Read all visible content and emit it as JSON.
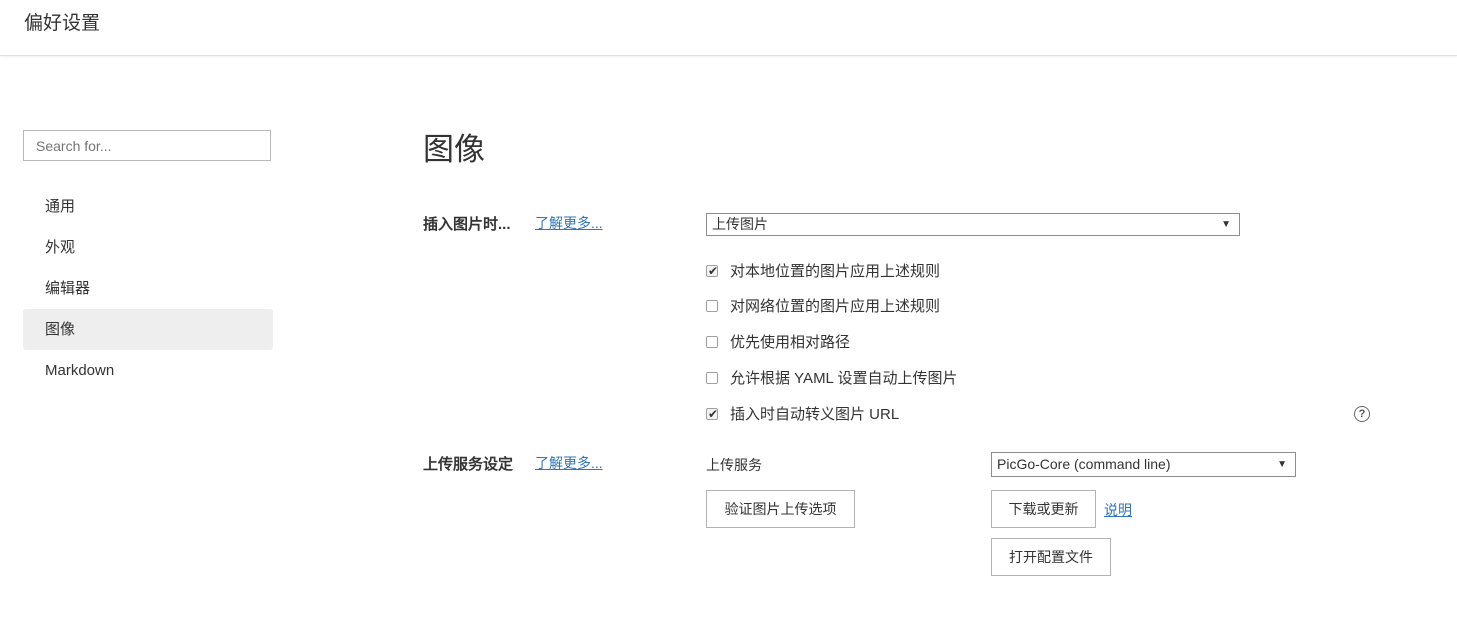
{
  "window": {
    "title": "偏好设置"
  },
  "search": {
    "placeholder": "Search for..."
  },
  "sidebar": {
    "items": [
      {
        "label": "通用"
      },
      {
        "label": "外观"
      },
      {
        "label": "编辑器"
      },
      {
        "label": "图像",
        "active": true
      },
      {
        "label": "Markdown"
      }
    ]
  },
  "main": {
    "heading": "图像",
    "insert_section": {
      "label": "插入图片时...",
      "learn_more": "了解更多...",
      "action_select_value": "上传图片",
      "options": [
        {
          "label": "对本地位置的图片应用上述规则",
          "checked": true
        },
        {
          "label": "对网络位置的图片应用上述规则",
          "checked": false
        },
        {
          "label": "优先使用相对路径",
          "checked": false
        },
        {
          "label": "允许根据 YAML 设置自动上传图片",
          "checked": false
        },
        {
          "label": "插入时自动转义图片 URL",
          "checked": true
        }
      ],
      "help_icon": "question-circle-icon"
    },
    "upload_section": {
      "label": "上传服务设定",
      "learn_more": "了解更多...",
      "service_label": "上传服务",
      "service_select_value": "PicGo-Core (command line)",
      "verify_button": "验证图片上传选项",
      "download_button": "下载或更新",
      "docs_link": "说明",
      "open_config_button": "打开配置文件"
    }
  },
  "colors": {
    "link": "#2f76b9",
    "active_nav_bg": "#eeeeee",
    "text": "#333333"
  }
}
